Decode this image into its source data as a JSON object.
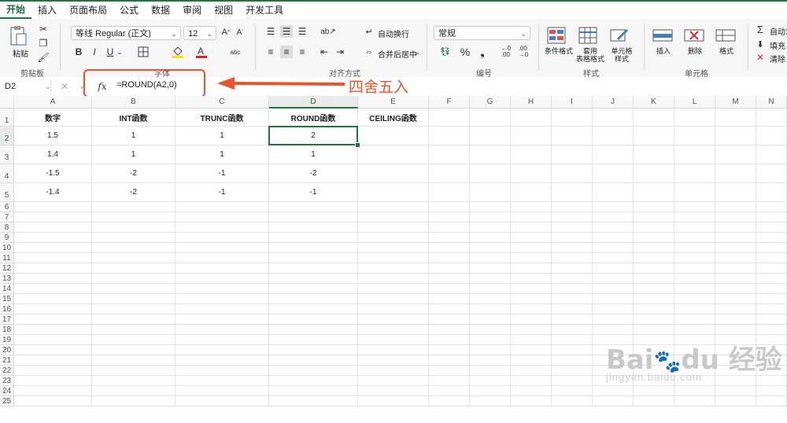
{
  "tabs": [
    "开始",
    "插入",
    "页面布局",
    "公式",
    "数据",
    "审阅",
    "视图",
    "开发工具"
  ],
  "ribbon": {
    "paste_label": "粘贴",
    "clipboard_group": "剪贴板",
    "font_name": "等线 Regular (正文)",
    "font_size": "12",
    "font_group": "字体",
    "bold": "B",
    "italic": "I",
    "underline": "U",
    "align_group": "对齐方式",
    "wrap_text": "自动换行",
    "merge_center": "合并后居中",
    "number_format": "常规",
    "number_group": "编号",
    "percent": "%",
    "conditional_format": "条件格式",
    "format_as_table": "套用\n表格格式",
    "cell_styles": "单元格\n样式",
    "styles_group": "样式",
    "insert": "插入",
    "delete": "删除",
    "format": "格式",
    "cells_group": "单元格",
    "autosum": "自动求",
    "fill": "填充",
    "clear": "清除"
  },
  "formula_bar": {
    "name_box": "D2",
    "fx": "fx",
    "formula": "=ROUND(A2,0)"
  },
  "annotation": "四舍五入",
  "columns": [
    "A",
    "B",
    "C",
    "D",
    "E",
    "F",
    "G",
    "H",
    "I",
    "J",
    "K",
    "L",
    "M",
    "N"
  ],
  "rows": [
    "1",
    "2",
    "3",
    "4",
    "5",
    "6",
    "7",
    "8",
    "9",
    "10",
    "11",
    "12",
    "13",
    "14",
    "15",
    "16",
    "17",
    "18",
    "19",
    "20",
    "21",
    "22",
    "23",
    "24",
    "25"
  ],
  "table": {
    "headers": [
      "数字",
      "INT函数",
      "TRUNC函数",
      "ROUND函数",
      "CEILING函数"
    ],
    "data": [
      [
        "1.5",
        "1",
        "1",
        "2",
        ""
      ],
      [
        "1.4",
        "1",
        "1",
        "1",
        ""
      ],
      [
        "-1.5",
        "-2",
        "-1",
        "-2",
        ""
      ],
      [
        "-1.4",
        "-2",
        "-1",
        "-1",
        ""
      ]
    ]
  },
  "watermark": {
    "logo": "Bai du 经验",
    "url": "jingyan.baidu.com"
  },
  "colors": {
    "excel_green": "#217346",
    "annotation": "#e8552c"
  }
}
